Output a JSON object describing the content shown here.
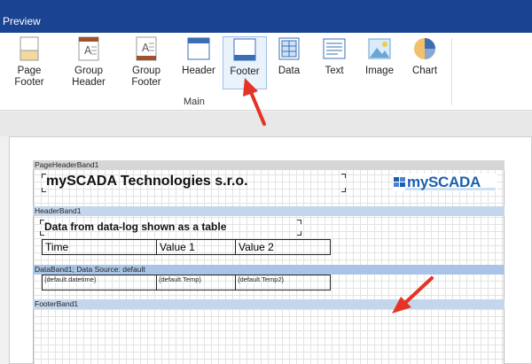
{
  "window": {
    "title": "Preview"
  },
  "ribbon": {
    "buttons": [
      {
        "label": "Page\nFooter",
        "icon": "page-footer-icon"
      },
      {
        "label": "Group\nHeader",
        "icon": "group-header-icon"
      },
      {
        "label": "Group\nFooter",
        "icon": "group-footer-icon"
      },
      {
        "label": "Header",
        "icon": "header-icon"
      },
      {
        "label": "Footer",
        "icon": "footer-icon"
      },
      {
        "label": "Data",
        "icon": "data-icon"
      },
      {
        "label": "Text",
        "icon": "text-icon"
      },
      {
        "label": "Image",
        "icon": "image-icon"
      },
      {
        "label": "Chart",
        "icon": "chart-icon"
      }
    ],
    "group_label": "Main"
  },
  "report": {
    "page_header_band": {
      "label": "PageHeaderBand1",
      "title": "mySCADA Technologies s.r.o.",
      "logo_text": "mySCADA"
    },
    "header_band": {
      "label": "HeaderBand1",
      "title": "Data from data-log shown as a table",
      "columns": [
        "Time",
        "Value 1",
        "Value 2"
      ]
    },
    "data_band": {
      "label": "DataBand1; Data Source: default",
      "fields": [
        "{default.datetime}",
        "{default.Temp}",
        "{default.Temp2}"
      ]
    },
    "footer_band": {
      "label": "FooterBand1"
    }
  },
  "colors": {
    "titlebar": "#1a4392",
    "arrow": "#e53324",
    "logo": "#1c5fae"
  }
}
